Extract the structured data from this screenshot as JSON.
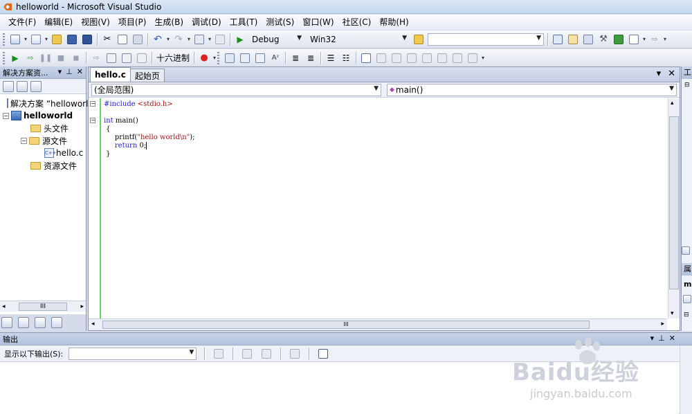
{
  "window": {
    "title": "helloworld - Microsoft Visual Studio"
  },
  "menu": [
    "文件(F)",
    "编辑(E)",
    "视图(V)",
    "项目(P)",
    "生成(B)",
    "调试(D)",
    "工具(T)",
    "测试(S)",
    "窗口(W)",
    "社区(C)",
    "帮助(H)"
  ],
  "toolbar": {
    "config": "Debug",
    "platform": "Win32",
    "find_combo": "",
    "hex_label": "十六进制"
  },
  "solution_explorer": {
    "title": "解决方案资...",
    "tree": {
      "solution": "解决方案 “helloworld”",
      "project": "helloworld",
      "header_folder": "头文件",
      "source_folder": "源文件",
      "source_file": "hello.c",
      "resource_folder": "资源文件"
    },
    "hscroll_label": "III"
  },
  "editor": {
    "tabs": [
      "hello.c",
      "起始页"
    ],
    "scope": "(全局范围)",
    "member": "main()",
    "code": {
      "l1_directive": "#include",
      "l1_header": " <stdio.h>",
      "l2": "",
      "l3_kw": "int",
      "l3_rest": " main()",
      "l4": " {",
      "l5_pre": "     printf(",
      "l5_str": "\"hello world\\n\"",
      "l5_post": ");",
      "l6_kw": "     return",
      "l6_rest": " 0;",
      "l7": " }"
    },
    "hscroll_label": "III"
  },
  "right_strip": {
    "labels": [
      "工",
      "属",
      "m"
    ]
  },
  "output": {
    "title": "输出",
    "show_output_from": "显示以下输出(S):",
    "source_value": ""
  },
  "watermark": {
    "brand": "Baidu经验",
    "url": "jingyan.baidu.com"
  }
}
